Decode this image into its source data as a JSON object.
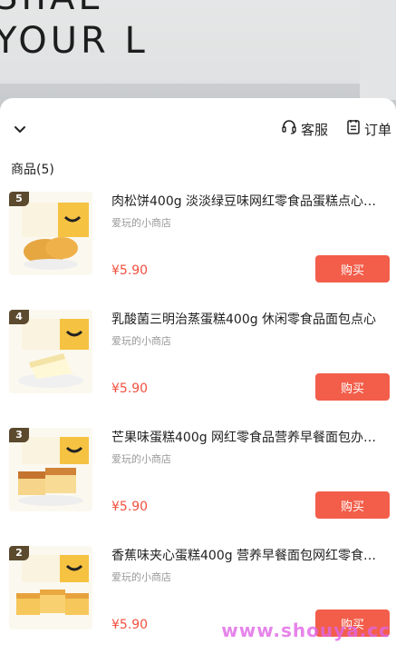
{
  "background": {
    "line1": "SIIAE",
    "line2": "YOUR L"
  },
  "header": {
    "service_label": "客服",
    "orders_label": "订单"
  },
  "section": {
    "title": "商品(5)"
  },
  "items": [
    {
      "rank": "5",
      "title": "肉松饼400g 淡淡绿豆味网红零食品蛋糕点心…",
      "shop": "爱玩的小商店",
      "price": "¥5.90",
      "buy_label": "购买"
    },
    {
      "rank": "4",
      "title": "乳酸菌三明治蒸蛋糕400g 休闲零食品面包点心",
      "shop": "爱玩的小商店",
      "price": "¥5.90",
      "buy_label": "购买"
    },
    {
      "rank": "3",
      "title": "芒果味蛋糕400g 网红零食品营养早餐面包办…",
      "shop": "爱玩的小商店",
      "price": "¥5.90",
      "buy_label": "购买"
    },
    {
      "rank": "2",
      "title": "香蕉味夹心蛋糕400g 营养早餐面包网红零食…",
      "shop": "爱玩的小商店",
      "price": "¥5.90",
      "buy_label": "购买"
    }
  ],
  "watermark": "www.shouya.cc",
  "colors": {
    "accent": "#f25e4a",
    "price": "#f2503f",
    "box_yellow": "#f5c242"
  }
}
